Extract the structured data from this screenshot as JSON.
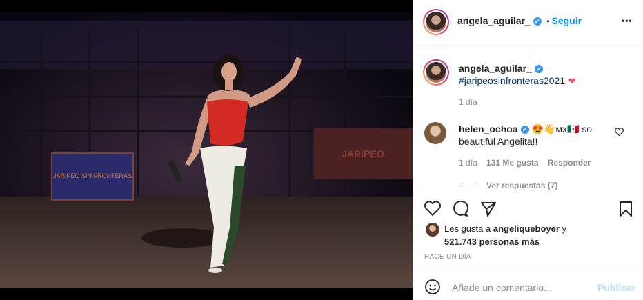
{
  "post": {
    "username": "angela_aguilar_",
    "follow_label": "Seguir",
    "more_label": "•••",
    "verified_glyph": "✔"
  },
  "caption": {
    "username": "angela_aguilar_",
    "hashtag": "#jaripeosinfronteras2021",
    "heart": "❤",
    "time": "1 día"
  },
  "comment": {
    "username": "helen_ochoa",
    "text_line1": "😍👋ᴍx🇲🇽 so",
    "text_line2": "beautiful Angelita!!",
    "time": "1 día",
    "likes": "131 Me gusta",
    "reply": "Responder",
    "view_replies": "Ver respuestas (7)"
  },
  "likes": {
    "prefix": "Les gusta a",
    "user": "angeliqueboyer",
    "conjunction": "y",
    "count": "521.743 personas más"
  },
  "timestamp": "HACE UN DÍA",
  "composer": {
    "placeholder": "Añade un comentario...",
    "publish": "Publicar"
  },
  "photo": {
    "banner_left": "JARIPEO SIN FRONTERAS",
    "banner_right": "JARIPEO"
  },
  "colors": {
    "accent": "#0095f6",
    "verified": "#3897f0",
    "heart": "#ed4956",
    "muted": "#8e8e8e"
  }
}
